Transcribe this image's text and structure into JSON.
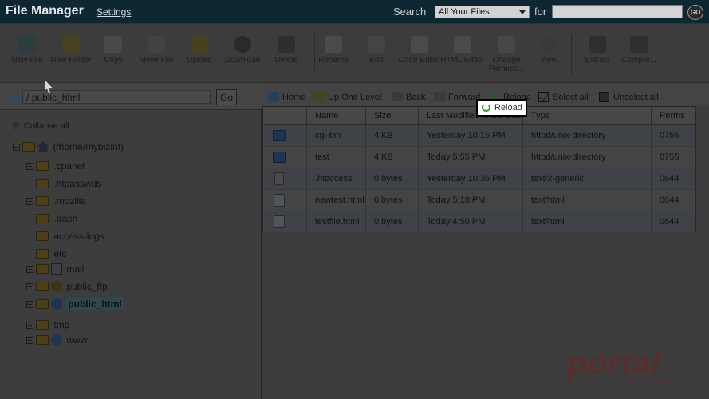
{
  "header": {
    "title": "File Manager",
    "settings_label": "Settings",
    "search_label": "Search",
    "search_scope": "All Your Files",
    "for_label": "for",
    "search_value": "",
    "go_label": "GO"
  },
  "toolbar": {
    "items": [
      {
        "label": "New File",
        "icon": "new-file-icon"
      },
      {
        "label": "New Folder",
        "icon": "new-folder-icon"
      },
      {
        "label": "Copy",
        "icon": "copy-icon"
      },
      {
        "label": "Move File",
        "icon": "move-file-icon"
      },
      {
        "label": "Upload",
        "icon": "upload-icon"
      },
      {
        "label": "Download",
        "icon": "download-icon"
      },
      {
        "label": "Delete",
        "icon": "delete-icon"
      },
      {
        "label": "Rename",
        "icon": "rename-icon"
      },
      {
        "label": "Edit",
        "icon": "edit-icon"
      },
      {
        "label": "Code Editor",
        "icon": "code-editor-icon"
      },
      {
        "label": "HTML Editor",
        "icon": "html-editor-icon"
      },
      {
        "label": "Change Permiss...",
        "icon": "permissions-icon"
      },
      {
        "label": "View",
        "icon": "view-icon"
      },
      {
        "label": "Extract",
        "icon": "extract-icon"
      },
      {
        "label": "Compre...",
        "icon": "compress-icon"
      }
    ]
  },
  "path": {
    "prefix": "/",
    "value": "public_html",
    "go_label": "Go"
  },
  "tree": {
    "collapse_all": "Collapse all",
    "root": "(/home/mybizinf)",
    "items": [
      {
        "label": ".cpanel",
        "expandable": true
      },
      {
        "label": ".htpasswds",
        "expandable": false
      },
      {
        "label": ".mozilla",
        "expandable": true
      },
      {
        "label": ".trash",
        "expandable": false
      },
      {
        "label": "access-logs",
        "expandable": false
      },
      {
        "label": "etc",
        "expandable": false
      },
      {
        "label": "mail",
        "expandable": true
      },
      {
        "label": "public_ftp",
        "expandable": true
      },
      {
        "label": "public_html",
        "expandable": true,
        "selected": true
      },
      {
        "label": "tmp",
        "expandable": true
      },
      {
        "label": "www",
        "expandable": true
      }
    ]
  },
  "nav": {
    "home": "Home",
    "up_one_level": "Up One Level",
    "back": "Back",
    "forward": "Forward",
    "reload": "Reload",
    "select_all": "Select all",
    "unselect_all": "Unselect all"
  },
  "tooltip": {
    "label": "Reload"
  },
  "files": {
    "columns": [
      "Name",
      "Size",
      "Last Modified (India Stan",
      "Type",
      "Perms"
    ],
    "rows": [
      {
        "icon": "folder-icon",
        "name": "cgi-bin",
        "size": "4 KB",
        "modified": "Yesterday 10:15 PM",
        "type": "httpd/unix-directory",
        "perms": "0755"
      },
      {
        "icon": "folder-icon",
        "name": "test",
        "size": "4 KB",
        "modified": "Today 5:55 PM",
        "type": "httpd/unix-directory",
        "perms": "0755"
      },
      {
        "icon": "text-file-icon",
        "name": ".htaccess",
        "size": "0 bytes",
        "modified": "Yesterday 10:36 PM",
        "type": "text/x-generic",
        "perms": "0644"
      },
      {
        "icon": "html-file-icon",
        "name": "newtest.html",
        "size": "0 bytes",
        "modified": "Today 5:18 PM",
        "type": "text/html",
        "perms": "0644"
      },
      {
        "icon": "html-file-icon",
        "name": "testfile.html",
        "size": "0 bytes",
        "modified": "Today 4:50 PM",
        "type": "text/html",
        "perms": "0644"
      }
    ]
  },
  "watermark": {
    "text": "portal",
    "sub": "web hosting"
  }
}
